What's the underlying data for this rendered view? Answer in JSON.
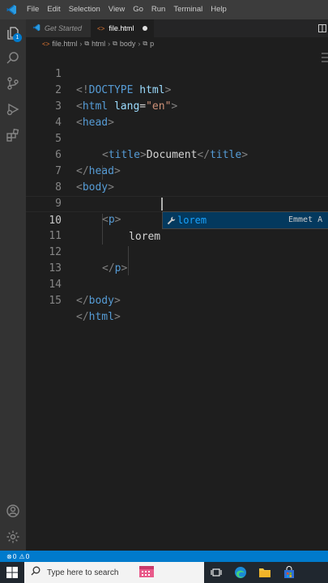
{
  "menubar": {
    "items": [
      "File",
      "Edit",
      "Selection",
      "View",
      "Go",
      "Run",
      "Terminal",
      "Help"
    ]
  },
  "activitybar": {
    "explorer_badge": "1"
  },
  "tabs": [
    {
      "label": "Get Started",
      "active": false
    },
    {
      "label": "file.html",
      "active": true,
      "dirty": true
    }
  ],
  "breadcrumb": [
    "file.html",
    "html",
    "body",
    "p"
  ],
  "editor": {
    "lines": [
      {
        "num": "1"
      },
      {
        "num": "2"
      },
      {
        "num": "3"
      },
      {
        "num": "4"
      },
      {
        "num": "5"
      },
      {
        "num": "6"
      },
      {
        "num": "7"
      },
      {
        "num": "8"
      },
      {
        "num": "9"
      },
      {
        "num": "10"
      },
      {
        "num": "11"
      },
      {
        "num": "12"
      },
      {
        "num": "13"
      },
      {
        "num": "14"
      },
      {
        "num": "15"
      }
    ],
    "tokens": {
      "doctype_open": "<!",
      "doctype_kw": "DOCTYPE",
      "doctype_rest": "html",
      "gt": ">",
      "lt": "<",
      "lt_slash": "</",
      "html": "html",
      "lang": "lang",
      "eq": "=",
      "lang_val": "\"en\"",
      "head": "head",
      "title": "title",
      "title_text": "Document",
      "body": "body",
      "p": "p",
      "typed": "lorem"
    }
  },
  "suggest": {
    "label": "lorem",
    "detail": "Emmet A"
  },
  "statusbar": {
    "errors": "0",
    "warnings": "0"
  },
  "taskbar": {
    "search_placeholder": "Type here to search"
  },
  "colors": {
    "accent": "#007acc",
    "tag": "#569cd6",
    "attr": "#9cdcfe",
    "string": "#ce9178"
  }
}
